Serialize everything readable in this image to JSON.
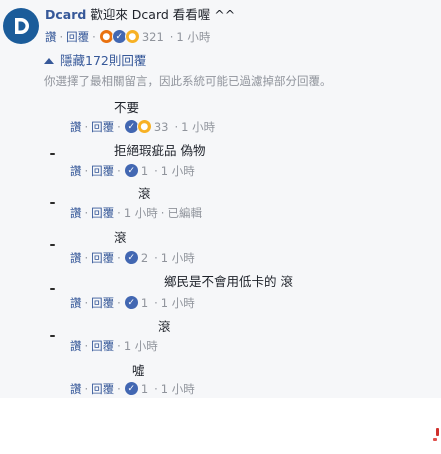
{
  "main_comment": {
    "author": "Dcard",
    "text": "歡迎來 Dcard 看看喔 ^^",
    "actions": {
      "like": "讚",
      "reply": "回覆",
      "separator": "·"
    },
    "reaction_count": "321",
    "time": "1 小時"
  },
  "hidden_replies": {
    "label": "隱藏172則回覆",
    "note": "你選擇了最相關留言，因此系統可能已過濾掉部分回覆。"
  },
  "replies": [
    {
      "text": "不要",
      "reaction_count": "33",
      "time": "1 小時",
      "edited": ""
    },
    {
      "text": "拒絕瑕疵品 偽物",
      "reaction_count": "1",
      "time": "1 小時",
      "edited": ""
    },
    {
      "text": "滾",
      "reaction_count": "",
      "time": "1 小時",
      "edited": "已編輯"
    },
    {
      "text": "滾",
      "reaction_count": "2",
      "time": "1 小時",
      "edited": ""
    },
    {
      "text": "鄉民是不會用低卡的 滾",
      "reaction_count": "1",
      "time": "1 小時",
      "edited": ""
    },
    {
      "text": "滾",
      "reaction_count": "",
      "time": "1 小時",
      "edited": ""
    },
    {
      "text": "噓",
      "reaction_count": "1",
      "time": "1 小時",
      "edited": ""
    }
  ],
  "colors": {
    "link": "#365899",
    "meta": "#90949c",
    "panel_background": "#f6f7f9",
    "like_reaction": "#4267b2",
    "haha_reaction": "#f7b125",
    "angry_reaction": "#e9710f",
    "avatar": "#1b5c9a"
  },
  "icons": [
    "dcard-logo-icon",
    "like-reaction-icon",
    "haha-reaction-icon",
    "angry-reaction-icon",
    "collapse-arrow-icon"
  ]
}
